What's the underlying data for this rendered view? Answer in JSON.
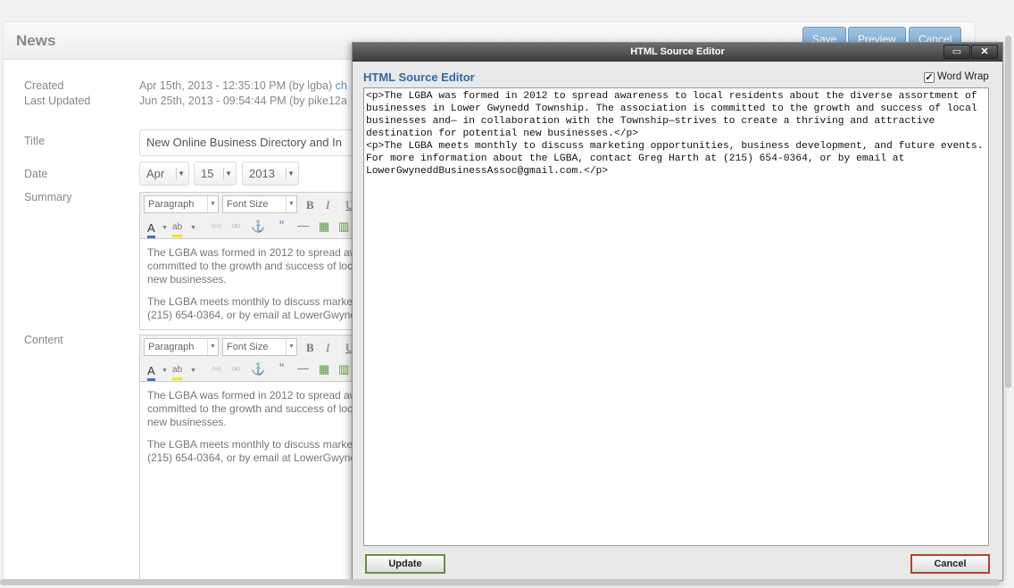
{
  "page": {
    "title": "News",
    "header_buttons": {
      "save": "Save",
      "preview": "Preview",
      "cancel": "Cancel"
    },
    "created_label": "Created",
    "created_value": "Apr 15th, 2013 - 12:35:10 PM (by lgba)",
    "created_link": "ch",
    "updated_label": "Last Updated",
    "updated_value": "Jun 25th, 2013 - 09:54:44 PM (by pike12a",
    "title_label": "Title",
    "title_value": "New Online Business Directory and In",
    "date_label": "Date",
    "date_month": "Apr",
    "date_day": "15",
    "date_year": "2013",
    "summary_label": "Summary",
    "content_label": "Content",
    "toolbar": {
      "format": "Paragraph",
      "font_size": "Font Size",
      "bold": "B",
      "italic": "I",
      "underline": "U"
    },
    "editor_text": {
      "line1": "The LGBA was formed in 2012 to spread aw",
      "line2": "committed to the growth and success of loc",
      "line3": "new businesses.",
      "line4": "The LGBA meets monthly to discuss marke",
      "line5": "(215) 654-0364, or by email at LowerGwyne"
    }
  },
  "dialog": {
    "title": "HTML Source Editor",
    "heading": "HTML Source Editor",
    "word_wrap_label": "Word Wrap",
    "word_wrap_checked": true,
    "source": "<p>The LGBA was formed in 2012 to spread awareness to local residents about the diverse assortment of businesses in Lower Gwynedd Township. The association is committed to the growth and success of local businesses and— in collaboration with the Township—strives to create a thriving and attractive destination for potential new businesses.</p>\n<p>The LGBA meets monthly to discuss marketing opportunities, business development, and future events. For more information about the LGBA, contact Greg Harth at (215) 654-0364, or by email at LowerGwyneddBusinessAssoc@gmail.com.</p>",
    "update_label": "Update",
    "cancel_label": "Cancel"
  },
  "colors": {
    "accent": "#2e6aa8",
    "update_border": "#6b8f3a",
    "cancel_border": "#b8402e"
  }
}
